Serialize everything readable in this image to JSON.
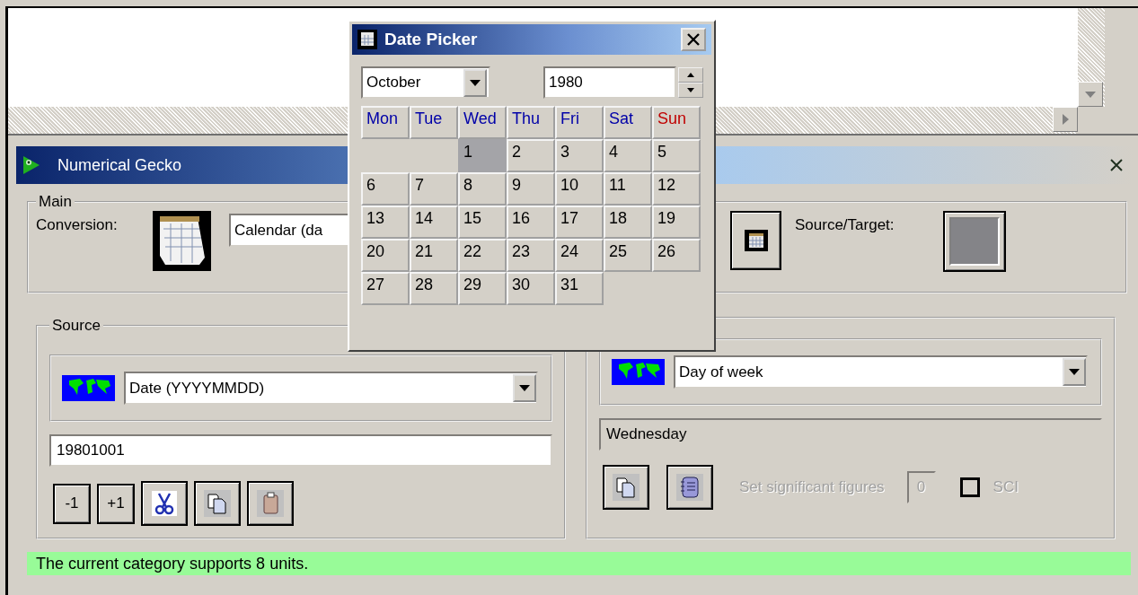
{
  "window": {
    "title": "Numerical Gecko"
  },
  "main": {
    "legend": "Main",
    "conversion_label": "Conversion:",
    "conversion_value": "Calendar (da",
    "source_target_label": "Source/Target:"
  },
  "source": {
    "legend": "Source",
    "unit": "Date (YYYYMMDD)",
    "value": "19801001",
    "buttons": [
      {
        "kind": "text",
        "label": "-1"
      },
      {
        "kind": "text",
        "label": "+1"
      },
      {
        "kind": "cut"
      },
      {
        "kind": "copy"
      },
      {
        "kind": "paste"
      }
    ]
  },
  "target": {
    "unit": "Day of week",
    "value": "Wednesday",
    "buttons": [
      {
        "kind": "copy"
      },
      {
        "kind": "notebook"
      }
    ],
    "sigfig": {
      "label": "Set significant figures",
      "value": "0",
      "disabled": true
    },
    "sci": {
      "label": "SCI",
      "checked": false,
      "disabled": true
    }
  },
  "status_bar": "The current category supports 8 units.",
  "date_picker": {
    "title": "Date Picker",
    "month": "October",
    "year": "1980",
    "weekdays": [
      {
        "label": "Mon",
        "color": "#0000a8"
      },
      {
        "label": "Tue",
        "color": "#0000a8"
      },
      {
        "label": "Wed",
        "color": "#0000a8"
      },
      {
        "label": "Thu",
        "color": "#0000a8"
      },
      {
        "label": "Fri",
        "color": "#0000a8"
      },
      {
        "label": "Sat",
        "color": "#0000a8"
      },
      {
        "label": "Sun",
        "color": "#c00000"
      }
    ],
    "weeks": [
      [
        {
          "kind": "empty"
        },
        {
          "kind": "empty"
        },
        {
          "label": "1",
          "selected": true
        },
        {
          "label": "2",
          "selected": false
        },
        {
          "label": "3",
          "selected": false
        },
        {
          "label": "4",
          "selected": false
        },
        {
          "label": "5",
          "selected": false
        }
      ],
      [
        {
          "label": "6",
          "selected": false
        },
        {
          "label": "7",
          "selected": false
        },
        {
          "label": "8",
          "selected": false
        },
        {
          "label": "9",
          "selected": false
        },
        {
          "label": "10",
          "selected": false
        },
        {
          "label": "11",
          "selected": false
        },
        {
          "label": "12",
          "selected": false
        }
      ],
      [
        {
          "label": "13",
          "selected": false
        },
        {
          "label": "14",
          "selected": false
        },
        {
          "label": "15",
          "selected": false
        },
        {
          "label": "16",
          "selected": false
        },
        {
          "label": "17",
          "selected": false
        },
        {
          "label": "18",
          "selected": false
        },
        {
          "label": "19",
          "selected": false
        }
      ],
      [
        {
          "label": "20",
          "selected": false
        },
        {
          "label": "21",
          "selected": false
        },
        {
          "label": "22",
          "selected": false
        },
        {
          "label": "23",
          "selected": false
        },
        {
          "label": "24",
          "selected": false
        },
        {
          "label": "25",
          "selected": false
        },
        {
          "label": "26",
          "selected": false
        }
      ],
      [
        {
          "label": "27",
          "selected": false
        },
        {
          "label": "28",
          "selected": false
        },
        {
          "label": "29",
          "selected": false
        },
        {
          "label": "30",
          "selected": false
        },
        {
          "label": "31",
          "selected": false
        },
        {
          "kind": "empty"
        },
        {
          "kind": "empty"
        }
      ]
    ]
  }
}
